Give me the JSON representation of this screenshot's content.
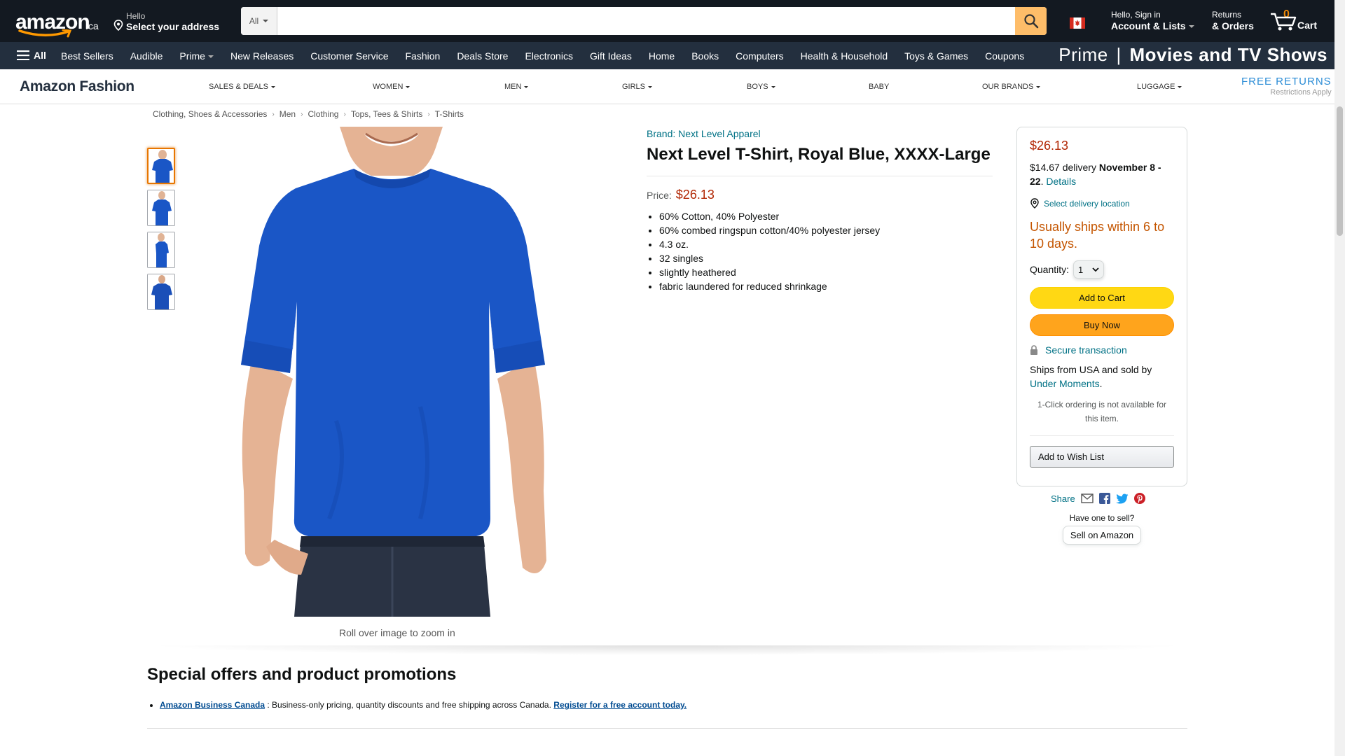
{
  "header": {
    "logo_text": "amazon",
    "logo_tld": ".ca",
    "address_line1": "Hello",
    "address_line2": "Select your address",
    "search_category": "All",
    "search_placeholder": "",
    "account_line1": "Hello, Sign in",
    "account_line2": "Account & Lists",
    "returns_line1": "Returns",
    "returns_line2": "& Orders",
    "cart_count": "0",
    "cart_label": "Cart"
  },
  "nav": {
    "all_label": "All",
    "items": [
      "Best Sellers",
      "Audible",
      "Prime",
      "New Releases",
      "Customer Service",
      "Fashion",
      "Deals Store",
      "Electronics",
      "Gift Ideas",
      "Home",
      "Books",
      "Computers",
      "Health & Household",
      "Toys & Games",
      "Coupons"
    ],
    "promo_prefix": "Prime",
    "promo_main": "Movies and TV Shows"
  },
  "subnav": {
    "brand": "Amazon Fashion",
    "items": [
      "SALES & DEALS",
      "WOMEN",
      "MEN",
      "GIRLS",
      "BOYS",
      "BABY",
      "OUR BRANDS",
      "LUGGAGE"
    ],
    "free_returns": "FREE RETURNS",
    "restrictions": "Restrictions Apply"
  },
  "breadcrumb": [
    "Clothing, Shoes & Accessories",
    "Men",
    "Clothing",
    "Tops, Tees & Shirts",
    "T-Shirts"
  ],
  "gallery": {
    "zoom_hint": "Roll over image to zoom in",
    "shirt_color": "#1a56c6"
  },
  "product": {
    "brand": "Brand: Next Level Apparel",
    "title": "Next Level T-Shirt, Royal Blue, XXXX-Large",
    "price_label": "Price:",
    "price": "$26.13",
    "bullets": [
      "60% Cotton, 40% Polyester",
      "60% combed ringspun cotton/40% polyester jersey",
      "4.3 oz.",
      "32 singles",
      "slightly heathered",
      "fabric laundered for reduced shrinkage"
    ]
  },
  "buybox": {
    "price": "$26.13",
    "delivery_prefix": "$14.67 delivery",
    "delivery_date": "November 8 - 22",
    "details_link": "Details",
    "location_link": "Select delivery location",
    "ships_note": "Usually ships within 6 to 10 days.",
    "quantity_label": "Quantity:",
    "quantity_value": "1",
    "add_to_cart": "Add to Cart",
    "buy_now": "Buy Now",
    "secure": "Secure transaction",
    "sold_prefix": "Ships from USA and sold by",
    "seller": "Under Moments",
    "one_click": "1-Click ordering is not available for this item.",
    "wish_list": "Add to Wish List"
  },
  "share": {
    "label": "Share",
    "have_one": "Have one to sell?",
    "sell_button": "Sell on Amazon"
  },
  "promotions": {
    "heading": "Special offers and product promotions",
    "link1": "Amazon Business Canada",
    "text": " : Business-only pricing, quantity discounts and free shipping across Canada. ",
    "link2": "Register for a free account today."
  }
}
